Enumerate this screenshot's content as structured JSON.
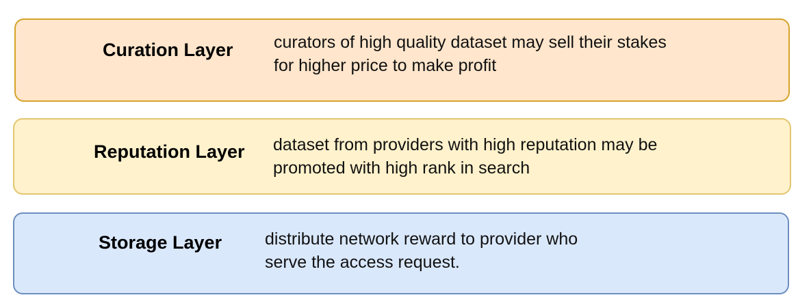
{
  "diagram": {
    "layers": [
      {
        "id": "curation",
        "title": "Curation Layer",
        "desc_lines": [
          "curators of high quality dataset may sell their stakes",
          "for higher price to make profit"
        ],
        "fill": "#ffe6cc",
        "stroke": "#d6a32a"
      },
      {
        "id": "reputation",
        "title": "Reputation Layer",
        "desc_lines": [
          "dataset from providers with high reputation may be",
          "promoted with high rank in search"
        ],
        "fill": "#fff2cc",
        "stroke": "#e3c670"
      },
      {
        "id": "storage",
        "title": "Storage Layer",
        "desc_lines": [
          "distribute network reward to provider who",
          "serve the access request."
        ],
        "fill": "#dae8fc",
        "stroke": "#6c8ebf"
      }
    ]
  }
}
